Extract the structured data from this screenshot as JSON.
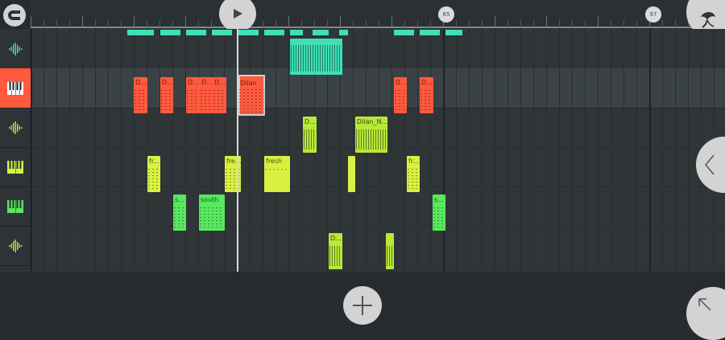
{
  "timeline": {
    "bar_markers": [
      {
        "label": "65"
      },
      {
        "label": "97"
      }
    ]
  },
  "tracks": [
    {
      "type": "audio",
      "icon": "waveform-icon",
      "color": "#3fe0b8",
      "active": false
    },
    {
      "type": "instrument",
      "icon": "piano-icon",
      "color": "#ff5a3d",
      "active": true
    },
    {
      "type": "audio",
      "icon": "waveform-icon",
      "color": "#b8e838",
      "active": false
    },
    {
      "type": "instrument",
      "icon": "piano-icon",
      "color": "#d8f040",
      "active": false
    },
    {
      "type": "instrument",
      "icon": "piano-icon",
      "color": "#58e85e",
      "active": false
    },
    {
      "type": "audio",
      "icon": "waveform-icon",
      "color": "#b8e838",
      "active": false
    }
  ],
  "clips": {
    "track1": [
      {
        "label": ""
      }
    ],
    "track2": [
      {
        "label": "D..."
      },
      {
        "label": "D..."
      },
      {
        "label": "D..."
      },
      {
        "label": "D..."
      },
      {
        "label": "D..."
      },
      {
        "label": "Dilan"
      },
      {
        "label": "D..."
      },
      {
        "label": "D..."
      }
    ],
    "track3": [
      {
        "label": "D..."
      },
      {
        "label": "Dilan_N..."
      }
    ],
    "track4": [
      {
        "label": "fr..."
      },
      {
        "label": "fre..."
      },
      {
        "label": "fresh"
      },
      {
        "label": ""
      },
      {
        "label": "fr..."
      }
    ],
    "track5": [
      {
        "label": "s..."
      },
      {
        "label": "south"
      },
      {
        "label": "s..."
      }
    ],
    "track6": [
      {
        "label": "D..."
      },
      {
        "label": ""
      }
    ]
  },
  "colors": {
    "background": "#262b2f",
    "grid": "#303538",
    "highlight_lane": "#3b4246",
    "teal": "#3fe0b8",
    "orange": "#ff5a3d",
    "lime": "#b8e838",
    "yellow": "#d8f040",
    "green": "#58e85e"
  }
}
